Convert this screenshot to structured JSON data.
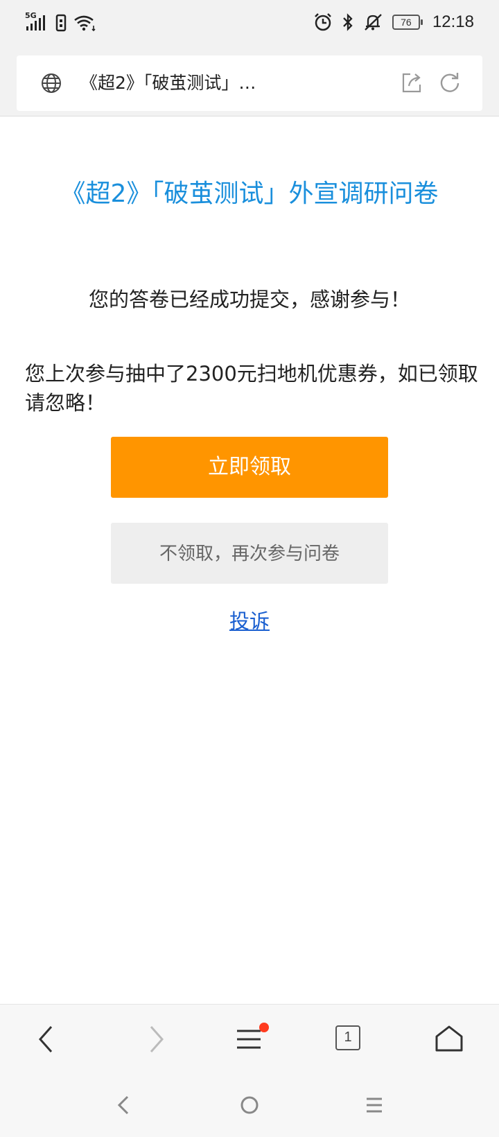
{
  "status_bar": {
    "network": "5G",
    "battery": "76",
    "time": "12:18"
  },
  "address_bar": {
    "page_title": "《超2》「破茧测试」…"
  },
  "survey": {
    "title": "《超2》「破茧测试」外宣调研问卷",
    "thanks": "您的答卷已经成功提交，感谢参与！",
    "prize_message": "您上次参与抽中了2300元扫地机优惠券，如已领取请忽略！",
    "claim_button": "立即领取",
    "again_button": "不领取，再次参与问卷",
    "complain_link": "投诉"
  },
  "toolbar": {
    "tabs_count": "1"
  },
  "colors": {
    "title_blue": "#1a8fdc",
    "claim_orange": "#ff9500",
    "link_blue": "#1a5fd0",
    "notification_red": "#ff3b1f"
  }
}
